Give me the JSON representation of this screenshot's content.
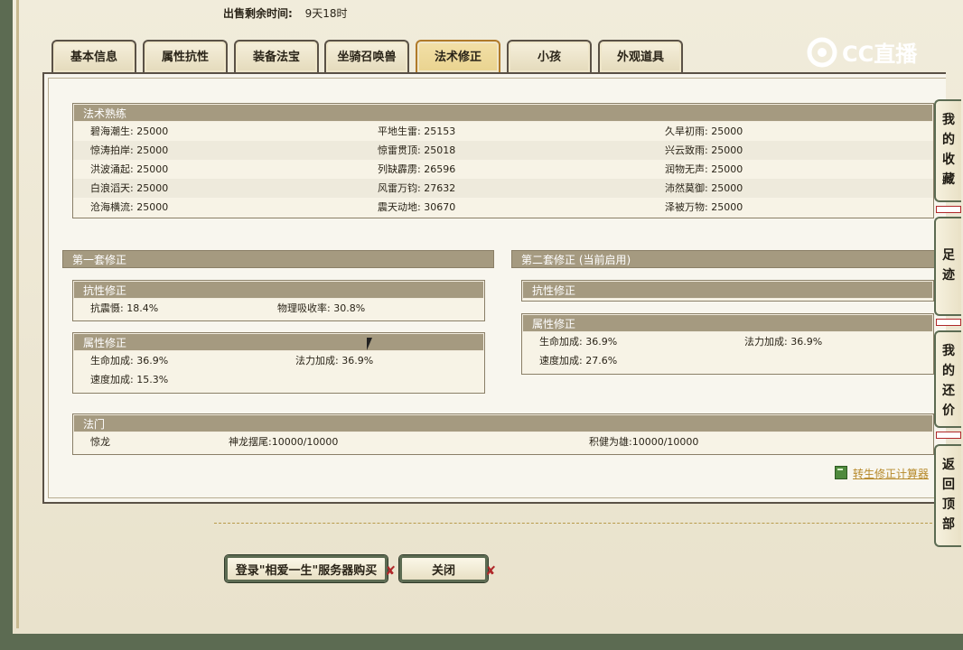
{
  "sale": {
    "label": "出售剩余时间:",
    "value": "9天18时"
  },
  "tabs": [
    "基本信息",
    "属性抗性",
    "装备法宝",
    "坐骑召唤兽",
    "法术修正",
    "小孩",
    "外观道具"
  ],
  "active_tab": "法术修正",
  "logo": "CC直播",
  "mastery": {
    "title": "法术熟练",
    "rows": [
      [
        "碧海潮生: 25000",
        "平地生雷: 25153",
        "久旱初雨: 25000"
      ],
      [
        "惊涛拍岸: 25000",
        "惊雷贯顶: 25018",
        "兴云致雨: 25000"
      ],
      [
        "洪波涌起: 25000",
        "列缺霹雳: 26596",
        "润物无声: 25000"
      ],
      [
        "白浪滔天: 25000",
        "风雷万钧: 27632",
        "沛然莫御: 25000"
      ],
      [
        "沧海横流: 25000",
        "震天动地: 30670",
        "泽被万物: 25000"
      ]
    ]
  },
  "set1": {
    "title": "第一套修正",
    "resist": {
      "title": "抗性修正",
      "items": [
        "抗震慑: 18.4%",
        "物理吸收率: 30.8%"
      ]
    },
    "attr": {
      "title": "属性修正",
      "items": [
        "生命加成: 36.9%",
        "法力加成: 36.9%",
        "速度加成: 15.3%"
      ]
    }
  },
  "set2": {
    "title": "第二套修正 (当前启用)",
    "resist": {
      "title": "抗性修正"
    },
    "attr": {
      "title": "属性修正",
      "items": [
        "生命加成: 36.9%",
        "法力加成: 36.9%",
        "速度加成: 27.6%"
      ]
    }
  },
  "famen": {
    "title": "法门",
    "items": [
      "惊龙",
      "神龙摆尾:10000/10000",
      "积健为雄:10000/10000"
    ]
  },
  "calc_link": "转生修正计算器",
  "buttons": {
    "login": "登录\"相爱一生\"服务器购买",
    "close": "关闭"
  },
  "side": {
    "favorites": [
      "我",
      "的",
      "收",
      "藏"
    ],
    "footprint": [
      "足",
      "迹"
    ],
    "bargain": [
      "我",
      "的",
      "还",
      "价"
    ],
    "top": [
      "返",
      "回",
      "顶",
      "部"
    ]
  }
}
